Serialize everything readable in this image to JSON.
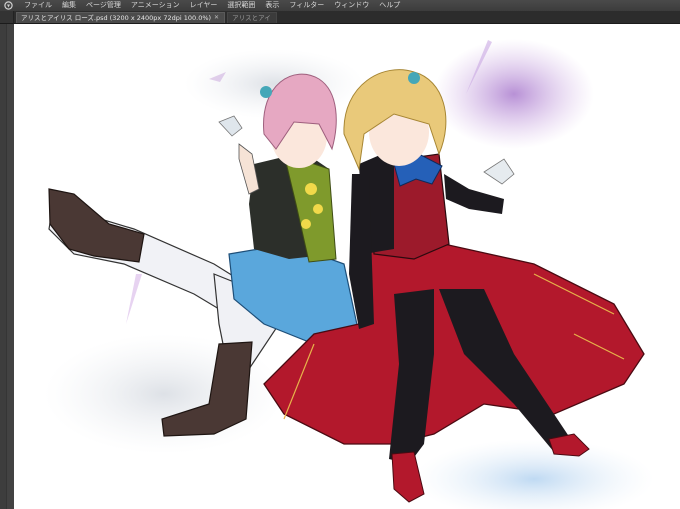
{
  "menubar": {
    "items": [
      "ファイル",
      "編集",
      "ページ管理",
      "アニメーション",
      "レイヤー",
      "選択範囲",
      "表示",
      "フィルター",
      "ウィンドウ",
      "ヘルプ"
    ]
  },
  "tabs": [
    {
      "label": "アリスとアイリス ローズ.psd (3200 x 2400px 72dpi 100.0%)",
      "active": true
    },
    {
      "label": "アリスとアイ",
      "active": false
    }
  ],
  "icons": {
    "app": "app-logo-icon",
    "tab_close": "close-icon"
  },
  "colors": {
    "menubar_bg": "#434343",
    "canvas_bg": "#ffffff",
    "red_dress": "#b3182c",
    "green_vest": "#7f9a2c",
    "blue_skirt": "#5aa7dc"
  }
}
